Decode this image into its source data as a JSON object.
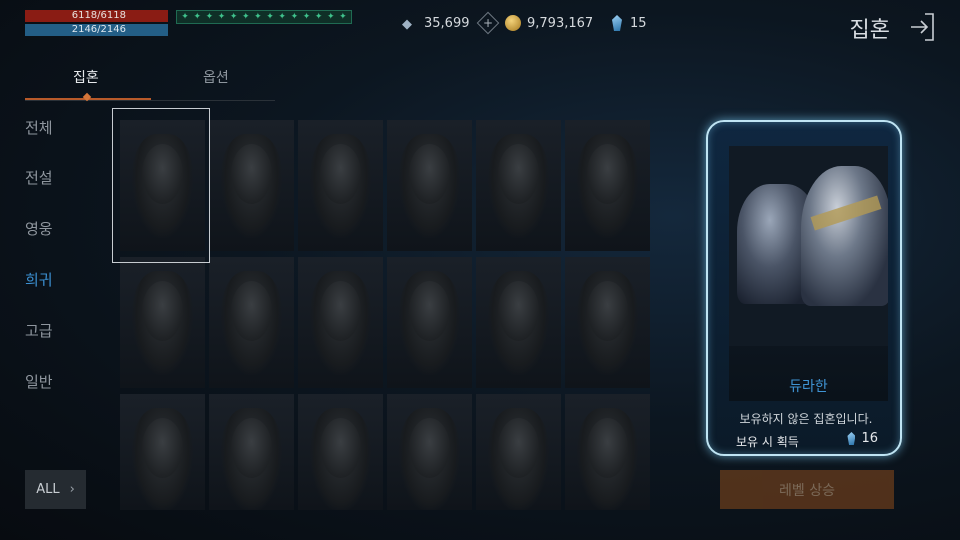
{
  "hud": {
    "hp": "6118/6118",
    "mp": "2146/2146",
    "buffs": [
      "✦",
      "✦",
      "✦",
      "✦",
      "✦",
      "✦",
      "✦",
      "✦",
      "✦",
      "✦",
      "✦",
      "✦",
      "✦",
      "✦"
    ],
    "currencies": [
      {
        "icon": "diamond-icon",
        "value": "35,699"
      },
      {
        "icon": "gold-coin-icon",
        "value": "9,793,167"
      },
      {
        "icon": "blue-crystal-icon",
        "value": "15"
      }
    ]
  },
  "header": {
    "title": "집혼"
  },
  "tabs": [
    {
      "label": "집혼"
    },
    {
      "label": "옵션"
    }
  ],
  "categories": [
    "전체",
    "전설",
    "영웅",
    "희귀",
    "고급",
    "일반"
  ],
  "selected_category": "희귀",
  "all_button": {
    "label": "ALL"
  },
  "detail": {
    "name": "듀라한",
    "status": "보유하지 않은 집혼입니다.",
    "gain_label": "보유 시 획득",
    "gain_value": "16"
  },
  "level_button": {
    "label": "레벨 상승"
  },
  "colors": {
    "accent": "#3b8fd0",
    "card_border": "#bfe4f3",
    "tab_underline": "#b85a2a"
  }
}
